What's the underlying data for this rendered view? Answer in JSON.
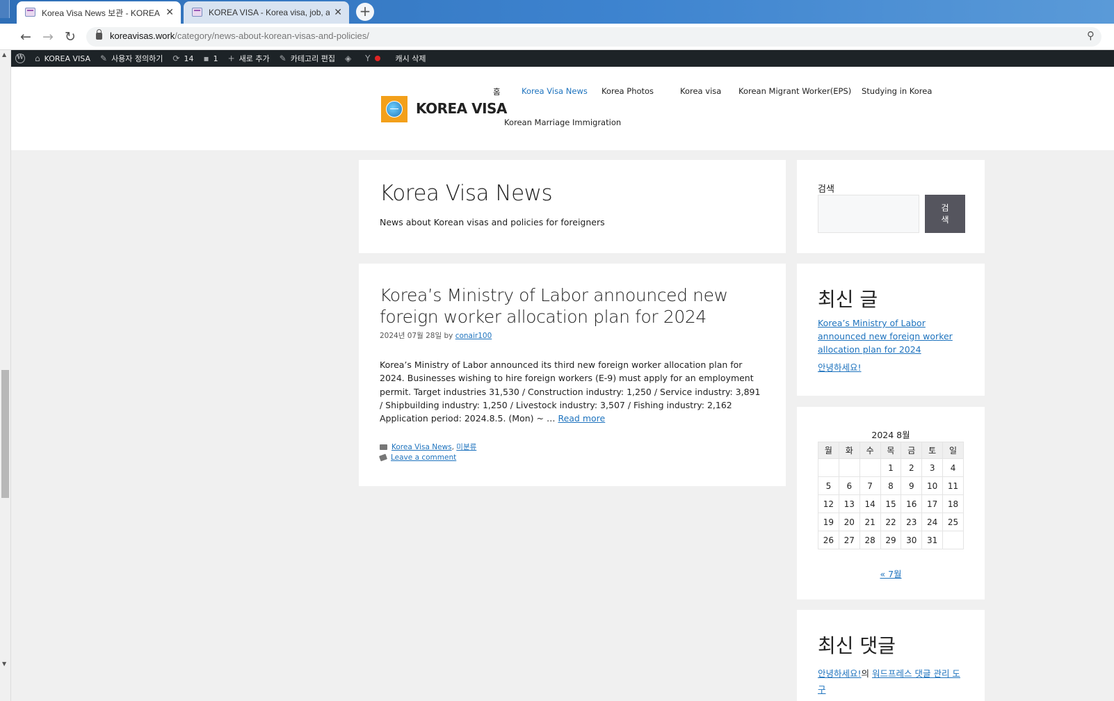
{
  "browser": {
    "tabs": [
      {
        "title": "Korea Visa News 보관 - KOREA VISA",
        "active": true
      },
      {
        "title": "KOREA VISA - Korea visa, job, and life",
        "active": false
      }
    ],
    "url_host": "koreavisas.work",
    "url_path": "/category/news-about-korean-visas-and-policies/"
  },
  "adminbar": {
    "site": "KOREA VISA",
    "customize": "사용자 정의하기",
    "updates_count": "14",
    "comments_count": "1",
    "new": "새로 추가",
    "edit_category": "카테고리 편집",
    "cache": "캐시 삭제"
  },
  "header": {
    "site_title": "KOREA VISA",
    "menu": [
      "홈",
      "Korea Visa News",
      "Korea Photos",
      "Korea visa",
      "Korean Migrant Worker(EPS)",
      "Studying in Korea",
      "Korean Marriage Immigration"
    ]
  },
  "archive": {
    "title": "Korea Visa News",
    "description": "News about Korean visas and policies for foreigners"
  },
  "post": {
    "title": "Korea’s Ministry of Labor announced new foreign worker allocation plan for 2024",
    "date": "2024년 07월 28일",
    "by": "by",
    "author": "conair100",
    "excerpt": "Korea’s Ministry of Labor announced its third new foreign worker allocation plan for 2024. Businesses wishing to hire foreign workers (E-9) must apply for an employment permit. Target industries 31,530 / Construction industry: 1,250 / Service industry: 3,891 / Shipbuilding industry: 1,250 / Livestock industry: 3,507 / Fishing industry: 2,162 Application period: 2024.8.5. (Mon) ~ …",
    "read_more": "Read more",
    "category1": "Korea Visa News",
    "category_sep": ",",
    "category2": "미분류",
    "comment_link": "Leave a comment"
  },
  "sidebar": {
    "search_label": "검색",
    "search_button": "검색",
    "recent_posts_title": "최신 글",
    "recent_posts": [
      "Korea’s Ministry of Labor announced new foreign worker allocation plan for 2024",
      "안녕하세요!"
    ],
    "calendar_caption": "2024 8월",
    "calendar_days": [
      "월",
      "화",
      "수",
      "목",
      "금",
      "토",
      "일"
    ],
    "calendar_weeks": [
      [
        "",
        "",
        "",
        "1",
        "2",
        "3",
        "4"
      ],
      [
        "5",
        "6",
        "7",
        "8",
        "9",
        "10",
        "11"
      ],
      [
        "12",
        "13",
        "14",
        "15",
        "16",
        "17",
        "18"
      ],
      [
        "19",
        "20",
        "21",
        "22",
        "23",
        "24",
        "25"
      ],
      [
        "26",
        "27",
        "28",
        "29",
        "30",
        "31",
        ""
      ]
    ],
    "calendar_prev": "« 7월",
    "recent_comments_title": "최신 댓글",
    "comment_post": "안녕하세요!",
    "comment_of": "의",
    "comment_author": "워드프레스 댓글 관리 도구"
  }
}
